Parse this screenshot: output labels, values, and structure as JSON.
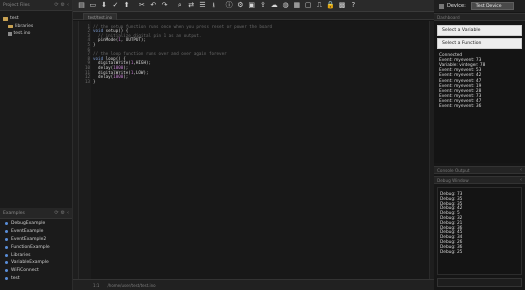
{
  "left_panel": {
    "header": "Project Files",
    "tree": [
      {
        "label": "test",
        "type": "folder",
        "indent": 0
      },
      {
        "label": "libraries",
        "type": "folder",
        "indent": 1
      },
      {
        "label": "test.ino",
        "type": "file",
        "indent": 1
      }
    ],
    "examples_header": "Examples",
    "examples": [
      "DebugExample",
      "EventExample",
      "EventExample2",
      "FunctionExample",
      "Libraries",
      "VariableExample",
      "WiFiConnect",
      "test"
    ]
  },
  "toolbar": {
    "icons": [
      "new-file-icon",
      "open-icon",
      "save-icon",
      "compile-icon",
      "upload-icon",
      "cut-icon",
      "undo-icon",
      "redo-icon",
      "search-icon",
      "replace-icon",
      "indent-icon",
      "download-icon",
      "info-icon",
      "settings-icon",
      "folder-icon",
      "upload-arrow-icon",
      "cloud-icon",
      "globe-icon",
      "library-icon",
      "terminal-icon",
      "serial-icon",
      "lock-icon",
      "board-icon",
      "help-icon"
    ]
  },
  "tabs": [
    {
      "label": "test/test.ino"
    }
  ],
  "editor": {
    "lines": [
      {
        "n": "1",
        "parts": [
          {
            "t": "// the setup function runs once when you press reset or power the board",
            "c": "cm"
          }
        ]
      },
      {
        "n": "2",
        "parts": [
          {
            "t": "void",
            "c": "kw"
          },
          {
            "t": " setup() {",
            "c": ""
          }
        ]
      },
      {
        "n": "3",
        "parts": [
          {
            "t": "  // initialize digital pin 1 as an output.",
            "c": "cm"
          }
        ]
      },
      {
        "n": "4",
        "parts": [
          {
            "t": "  pinMode(",
            "c": ""
          },
          {
            "t": "1",
            "c": "nm"
          },
          {
            "t": ", OUTPUT);",
            "c": ""
          }
        ]
      },
      {
        "n": "5",
        "parts": [
          {
            "t": "}",
            "c": ""
          }
        ]
      },
      {
        "n": "6",
        "parts": [
          {
            "t": "",
            "c": ""
          }
        ]
      },
      {
        "n": "7",
        "parts": [
          {
            "t": "// the loop function runs over and over again forever",
            "c": "cm"
          }
        ]
      },
      {
        "n": "8",
        "parts": [
          {
            "t": "void",
            "c": "kw"
          },
          {
            "t": " loop() {",
            "c": ""
          }
        ]
      },
      {
        "n": "9",
        "parts": [
          {
            "t": "  digitalWrite(",
            "c": ""
          },
          {
            "t": "1",
            "c": "nm"
          },
          {
            "t": ",HIGH);",
            "c": ""
          }
        ]
      },
      {
        "n": "10",
        "parts": [
          {
            "t": "  delay(",
            "c": ""
          },
          {
            "t": "1000",
            "c": "nm"
          },
          {
            "t": ");",
            "c": ""
          }
        ]
      },
      {
        "n": "11",
        "parts": [
          {
            "t": "  digitalWrite(",
            "c": ""
          },
          {
            "t": "1",
            "c": "nm"
          },
          {
            "t": ",LOW);",
            "c": ""
          }
        ]
      },
      {
        "n": "12",
        "parts": [
          {
            "t": "  delay(",
            "c": ""
          },
          {
            "t": "1000",
            "c": "nm"
          },
          {
            "t": ");",
            "c": ""
          }
        ]
      },
      {
        "n": "13",
        "parts": [
          {
            "t": "}",
            "c": ""
          }
        ]
      }
    ]
  },
  "status_bar": {
    "position": "1:1",
    "path": "/home/user/test/test.ino"
  },
  "right_panel": {
    "device_label": "Device:",
    "device_value": "Test Device",
    "dashboard_header": "Dashboard",
    "select_variable": "Select a Variable",
    "select_function": "Select a Function",
    "events": [
      "Connected",
      "Event: myevent: 73",
      "Variable: vinteger: 78",
      "Event: myevent: 53",
      "Event: myevent: 42",
      "Event: myevent: 47",
      "Event: myevent: 19",
      "Event: myevent: 28",
      "Event: myevent: 73",
      "Event: myevent: 47",
      "Event: myevent: 36"
    ],
    "console_header": "Console Output",
    "debug_header": "Debug Window",
    "debug_lines": [
      "Debug: 73",
      "Debug: 35",
      "Debug: 35",
      "Debug: 42",
      "Debug: 5",
      "Debug: 32",
      "Debug: 21",
      "Debug: 36",
      "Debug: 45",
      "Debug: 34",
      "Debug: 26",
      "Debug: 36",
      "Debug: 25"
    ]
  },
  "colors": {
    "background": "#161616",
    "keyword": "#7e9fd6",
    "number": "#c47fd0",
    "comment": "#6a6a6a",
    "folder": "#c9a253",
    "example_dot": "#5a8ed8"
  }
}
